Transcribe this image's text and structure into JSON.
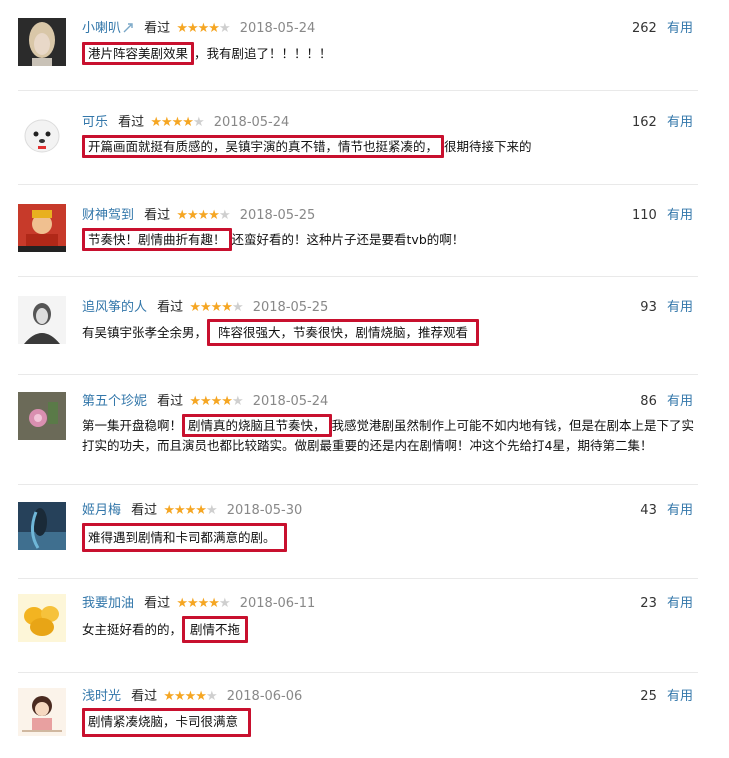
{
  "vote_label": "有用",
  "watched_label": "看过",
  "colors": {
    "username": "#3377aa",
    "star": "#f5a623",
    "highlight_box": "#c8102e"
  },
  "reviews": [
    {
      "user": "小喇叭",
      "badge_icon": "share-icon",
      "stars": 4,
      "date": "2018-05-24",
      "votes": "262",
      "highlight": "港片阵容美剧效果",
      "rest": "，我有剧追了！！！！！",
      "prefix": ""
    },
    {
      "user": "可乐",
      "stars": 4,
      "date": "2018-05-24",
      "votes": "162",
      "highlight": "开篇画面就挺有质感的，吴镇宇演的真不错，情节也挺紧凑的，",
      "rest": "很期待接下来的",
      "prefix": ""
    },
    {
      "user": "财神驾到",
      "stars": 4,
      "date": "2018-05-25",
      "votes": "110",
      "highlight": "节奏快！剧情曲折有趣！",
      "rest": "还蛮好看的！这种片子还是要看tvb的啊！",
      "prefix": ""
    },
    {
      "user": "追风筝的人",
      "stars": 4,
      "date": "2018-05-25",
      "votes": "93",
      "prefix": "有吴镇宇张孝全余男，",
      "highlight": "阵容很强大，节奏很快，剧情烧脑，推荐观看",
      "rest": ""
    },
    {
      "user": "第五个珍妮",
      "stars": 4,
      "date": "2018-05-24",
      "votes": "86",
      "prefix": "第一集开盘稳啊！",
      "highlight": "剧情真的烧脑且节奏快，",
      "rest": "我感觉港剧虽然制作上可能不如内地有钱，但是在剧本上是下了实打实的功夫，而且演员也都比较踏实。做剧最重要的还是内在剧情啊！冲这个先给打4星，期待第二集！"
    },
    {
      "user": "姬月梅",
      "stars": 4,
      "date": "2018-05-30",
      "votes": "43",
      "prefix": "",
      "highlight": "难得遇到剧情和卡司都满意的剧。",
      "rest": ""
    },
    {
      "user": "我要加油",
      "stars": 4,
      "date": "2018-06-11",
      "votes": "23",
      "prefix": "女主挺好看的的，",
      "highlight": "剧情不拖",
      "rest": ""
    },
    {
      "user": "浅时光",
      "stars": 4,
      "date": "2018-06-06",
      "votes": "25",
      "prefix": "",
      "highlight": "剧情紧凑烧脑，卡司很满意",
      "rest": ""
    }
  ]
}
